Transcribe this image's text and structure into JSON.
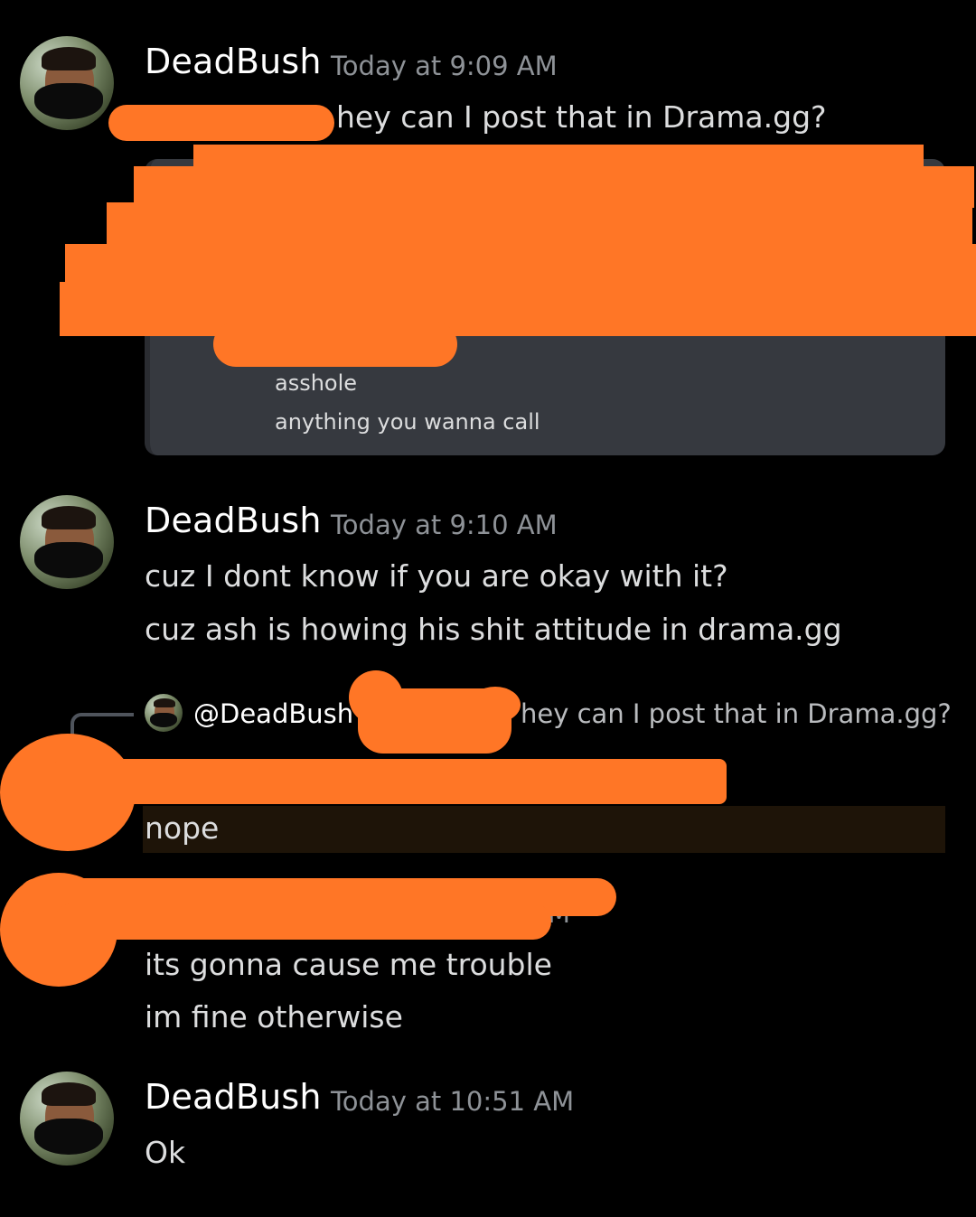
{
  "messages": [
    {
      "username": "DeadBush",
      "timestamp": "Today at 9:09 AM",
      "text": "hey can I post that in Drama.gg?",
      "embed_lines": [
        "asshole",
        "anything you wanna call"
      ]
    },
    {
      "username": "DeadBush",
      "timestamp": "Today at 9:10 AM",
      "lines": [
        "cuz I dont know if you are okay with it?",
        "cuz ash is howing his shit attitude in drama.gg"
      ]
    },
    {
      "reply_to": "@DeadBush",
      "reply_text": "hey can I post that in Drama.gg?",
      "text": "nope"
    },
    {
      "timestamp_fragment": "M",
      "lines": [
        "its gonna cause me trouble",
        "im fine otherwise"
      ]
    },
    {
      "username": "DeadBush",
      "timestamp": "Today at 10:51 AM",
      "text": "Ok"
    }
  ],
  "colors": {
    "background": "#000000",
    "redaction": "#ff7626",
    "embed_bg": "#36393f",
    "timestamp": "#8e9297"
  },
  "icons": [
    "avatar",
    "reply-spine"
  ]
}
